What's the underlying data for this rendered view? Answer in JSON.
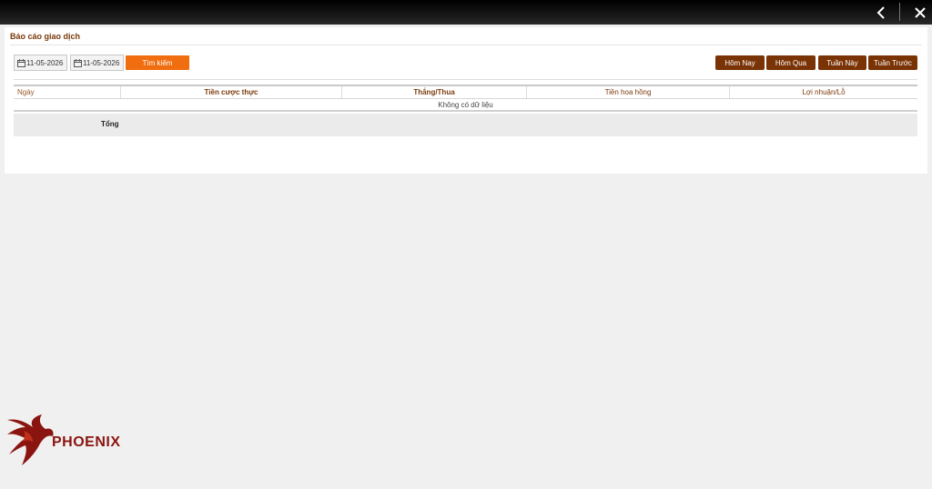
{
  "window": {
    "back_icon": "chevron-left-icon",
    "close_icon": "close-icon"
  },
  "report": {
    "title": "Báo cáo giao dịch",
    "date_from": "11-05-2026",
    "date_to": "11-05-2026",
    "search_label": "Tìm kiếm",
    "quick_filters": [
      "Hôm Nay",
      "Hôm Qua",
      "Tuần Này",
      "Tuần Trước"
    ]
  },
  "table": {
    "headers": [
      "Ngày",
      "Tiền cược thực",
      "Thắng/Thua",
      "Tiền hoa hồng",
      "Lợi nhuận/Lỗ"
    ],
    "empty_message": "Không có dữ liệu",
    "total_label": "Tổng"
  },
  "brand": {
    "name": "PHOENIX",
    "color": "#8a1410",
    "accent": "#f06e10",
    "button_color": "#7a3305"
  }
}
